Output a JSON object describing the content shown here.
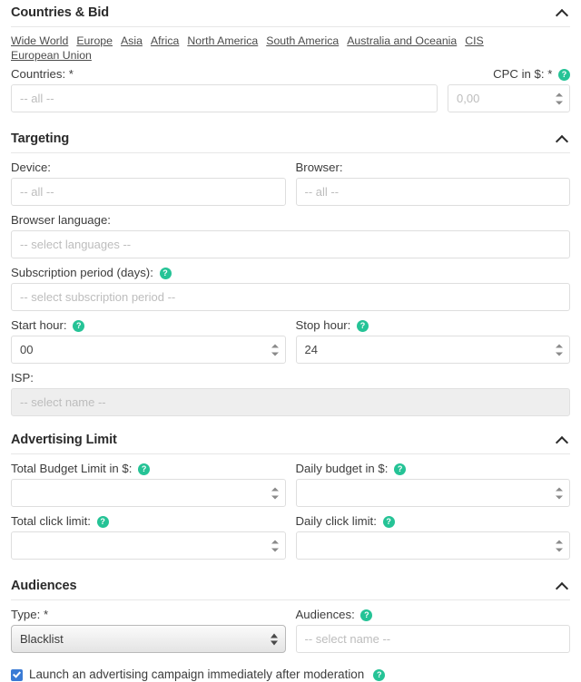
{
  "colors": {
    "help_bubble": "#25c396",
    "checkbox": "#3a7bd5",
    "border": "#dedede",
    "text": "#3a3a3a",
    "placeholder": "#bdbdbd",
    "disabled_bg": "#eeeeee"
  },
  "icons": {
    "collapse": "chevron-up-icon",
    "help": "help-icon",
    "spinner": "number-spinner-icon",
    "select_arrows": "select-arrows-icon",
    "checkbox": "checkbox-checked-icon"
  },
  "sections": {
    "countries_bid": {
      "title": "Countries & Bid",
      "region_links": [
        "Wide World",
        "Europe",
        "Asia",
        "Africa",
        "North America",
        "South America",
        "Australia and Oceania",
        "CIS",
        "European Union"
      ],
      "countries": {
        "label": "Countries:",
        "required": "*",
        "placeholder": "-- all --",
        "value": ""
      },
      "cpc": {
        "label": "CPC in $:",
        "required": "*",
        "help": "?",
        "placeholder": "0,00",
        "value": ""
      }
    },
    "targeting": {
      "title": "Targeting",
      "device": {
        "label": "Device:",
        "placeholder": "-- all --",
        "value": ""
      },
      "browser": {
        "label": "Browser:",
        "placeholder": "-- all --",
        "value": ""
      },
      "browser_language": {
        "label": "Browser language:",
        "placeholder": "-- select languages --",
        "value": ""
      },
      "subscription_period": {
        "label": "Subscription period (days):",
        "help": "?",
        "placeholder": "-- select subscription period --",
        "value": ""
      },
      "start_hour": {
        "label": "Start hour:",
        "help": "?",
        "value": "00"
      },
      "stop_hour": {
        "label": "Stop hour:",
        "help": "?",
        "value": "24"
      },
      "isp": {
        "label": "ISP:",
        "placeholder": "-- select name --",
        "value": "",
        "disabled": true
      }
    },
    "advertising_limit": {
      "title": "Advertising Limit",
      "total_budget": {
        "label": "Total Budget Limit in $:",
        "help": "?",
        "value": ""
      },
      "daily_budget": {
        "label": "Daily budget in $:",
        "help": "?",
        "value": ""
      },
      "total_click_limit": {
        "label": "Total click limit:",
        "help": "?",
        "value": ""
      },
      "daily_click_limit": {
        "label": "Daily click limit:",
        "help": "?",
        "value": ""
      }
    },
    "audiences": {
      "title": "Audiences",
      "type": {
        "label": "Type:",
        "required": "*",
        "selected": "Blacklist"
      },
      "audiences": {
        "label": "Audiences:",
        "help": "?",
        "placeholder": "-- select name --",
        "value": ""
      },
      "launch_checkbox": {
        "label": "Launch an advertising campaign immediately after moderation",
        "help": "?",
        "checked": true
      }
    }
  }
}
